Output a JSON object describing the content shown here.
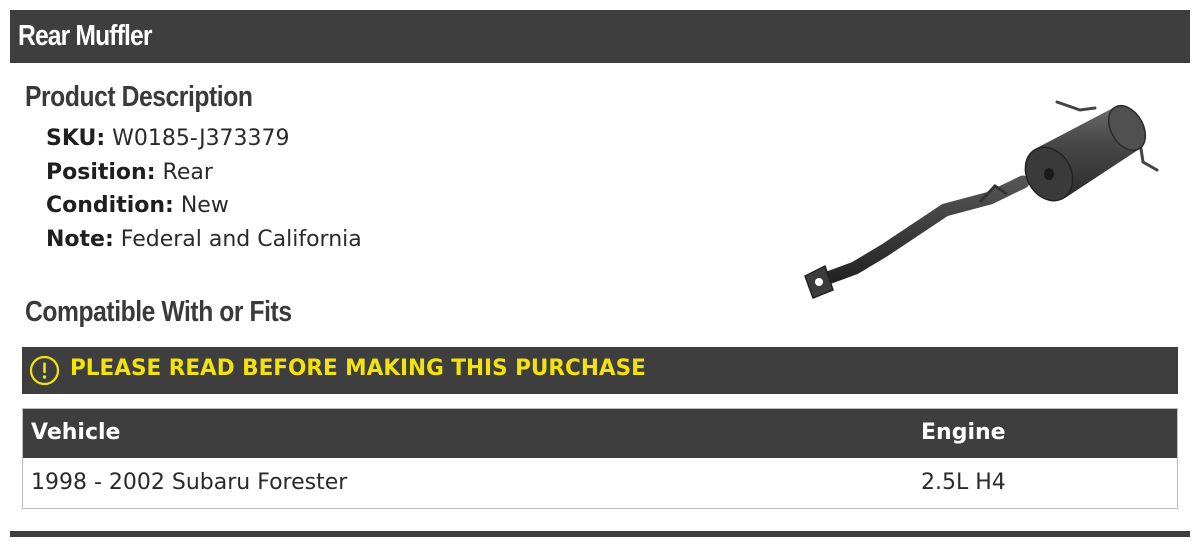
{
  "title": "Rear Muffler",
  "product_description": {
    "heading": "Product Description",
    "specs": [
      {
        "label": "SKU:",
        "value": "W0185-J373379"
      },
      {
        "label": "Position:",
        "value": "Rear"
      },
      {
        "label": "Condition:",
        "value": "New"
      },
      {
        "label": "Note:",
        "value": "Federal and California"
      }
    ]
  },
  "compatibility": {
    "heading": "Compatible With or Fits",
    "warning": {
      "icon": "exclamation-circle-icon",
      "text": "PLEASE READ BEFORE MAKING THIS PURCHASE"
    },
    "table": {
      "columns": [
        "Vehicle",
        "Engine"
      ],
      "rows": [
        [
          "1998 - 2002 Subaru Forester",
          "2.5L H4"
        ]
      ]
    }
  },
  "colors": {
    "header_background": "#3e3e3e",
    "warning_text": "#f2e20f"
  }
}
